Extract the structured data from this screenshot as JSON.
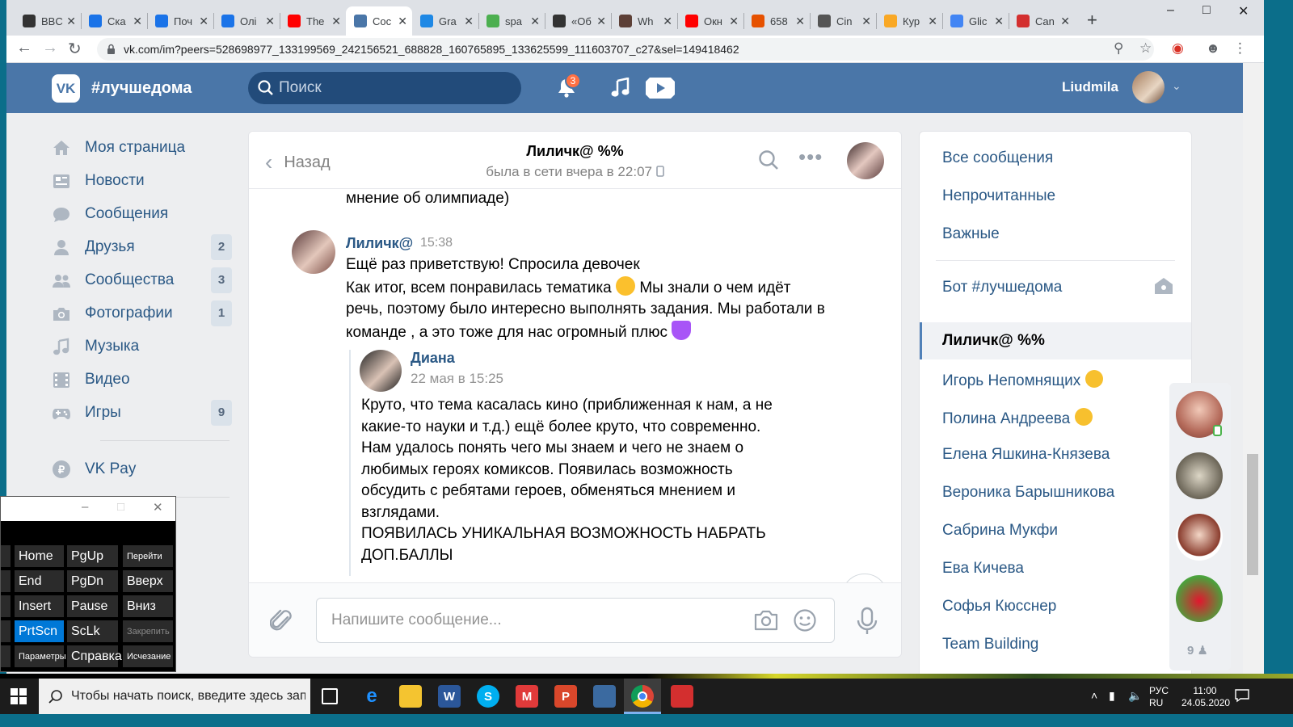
{
  "browser": {
    "tabs": [
      {
        "label": "BBC",
        "fav_color": "#333"
      },
      {
        "label": "Ска",
        "fav_color": "#1a73e8"
      },
      {
        "label": "Поч",
        "fav_color": "#1a73e8"
      },
      {
        "label": "Олі",
        "fav_color": "#1a73e8"
      },
      {
        "label": "The",
        "fav_color": "#ff0000"
      },
      {
        "label": "Сос",
        "fav_color": "#4a76a8"
      },
      {
        "label": "Gra",
        "fav_color": "#1e88e5"
      },
      {
        "label": "spa",
        "fav_color": "#4caf50"
      },
      {
        "label": "«Об",
        "fav_color": "#333"
      },
      {
        "label": "Wh",
        "fav_color": "#5d4037"
      },
      {
        "label": "Окн",
        "fav_color": "#ff0000"
      },
      {
        "label": "658",
        "fav_color": "#e65100"
      },
      {
        "label": "Cin",
        "fav_color": "#555"
      },
      {
        "label": "Кур",
        "fav_color": "#f9a825"
      },
      {
        "label": "Glic",
        "fav_color": "#4285f4"
      },
      {
        "label": "Can",
        "fav_color": "#d32f2f"
      }
    ],
    "active_tab": 5,
    "url": "vk.com/im?peers=528698977_133199569_242156521_688828_160765895_133625599_111603707_c27&sel=149418462"
  },
  "vk": {
    "logo": "VK",
    "group_tag": "#лучшедома",
    "search_placeholder": "Поиск",
    "notif_count": "3",
    "user_name": "Liudmila"
  },
  "nav": {
    "items": [
      {
        "label": "Моя страница",
        "icon": "home-icon",
        "count": ""
      },
      {
        "label": "Новости",
        "icon": "news-icon",
        "count": ""
      },
      {
        "label": "Сообщения",
        "icon": "messages-icon",
        "count": ""
      },
      {
        "label": "Друзья",
        "icon": "friends-icon",
        "count": "2"
      },
      {
        "label": "Сообщества",
        "icon": "communities-icon",
        "count": "3"
      },
      {
        "label": "Фотографии",
        "icon": "camera-icon",
        "count": "1"
      },
      {
        "label": "Музыка",
        "icon": "music-icon",
        "count": ""
      },
      {
        "label": "Видео",
        "icon": "video-icon",
        "count": ""
      },
      {
        "label": "Игры",
        "icon": "games-icon",
        "count": "9"
      }
    ],
    "vkpay": "VK Pay"
  },
  "chat": {
    "back_label": "Назад",
    "peer_name": "Лиличк@ %%",
    "peer_status": "была в сети вчера в 22:07",
    "prev_line": "мнение об олимпиаде)",
    "message": {
      "author": "Лиличк@",
      "time": "15:38",
      "line1": "Ещё раз приветствую! Спросила девочек",
      "line2a": "Как итог, всем понравилась тематика",
      "line2b": "Мы знали о чем идёт речь, поэтому было интересно выполнять задания. Мы работали в команде , а это тоже для нас огромный плюс"
    },
    "forwarded": {
      "author": "Диана",
      "date": "22 мая в 15:25",
      "lines": [
        "Круто, что тема касалась кино (приближенная к нам, а не",
        "какие-то науки и т.д.) ещё более круто, что современно.",
        "Нам удалось понять чего мы знаем и чего не знаем о",
        "любимых героях комиксов. Появилась возможность",
        "обсудить с ребятами героев, обменяться мнением и",
        "взглядами.",
        "ПОЯВИЛАСЬ УНИКАЛЬНАЯ ВОЗМОЖНОСТЬ НАБРАТЬ",
        "ДОП.БАЛЛЫ"
      ]
    },
    "input_placeholder": "Напишите сообщение..."
  },
  "right": {
    "filters": [
      "Все сообщения",
      "Непрочитанные",
      "Важные"
    ],
    "bot": "Бот #лучшедома",
    "chats": [
      {
        "name": "Лиличк@ %%",
        "emoji": false,
        "active": true
      },
      {
        "name": "Игорь Непомнящих",
        "emoji": true,
        "active": false
      },
      {
        "name": "Полина Андреева",
        "emoji": true,
        "active": false
      },
      {
        "name": "Елена Яшкина-Князева",
        "emoji": false,
        "active": false
      },
      {
        "name": "Вероника Барышникова",
        "emoji": false,
        "active": false
      },
      {
        "name": "Сабрина Мукфи",
        "emoji": false,
        "active": false
      },
      {
        "name": "Ева Кичева",
        "emoji": false,
        "active": false
      },
      {
        "name": "Софья Кюсснер",
        "emoji": false,
        "active": false
      },
      {
        "name": "Team Building",
        "emoji": false,
        "active": false
      }
    ],
    "rail_count": "9"
  },
  "osk": {
    "keys": [
      {
        "label": "Home",
        "col": 0,
        "row": 0,
        "style": ""
      },
      {
        "label": "PgUp",
        "col": 1,
        "row": 0,
        "style": ""
      },
      {
        "label": "Перейти",
        "col": 2,
        "row": 0,
        "style": "small"
      },
      {
        "label": "End",
        "col": 0,
        "row": 1,
        "style": ""
      },
      {
        "label": "PgDn",
        "col": 1,
        "row": 1,
        "style": ""
      },
      {
        "label": "Вверх",
        "col": 2,
        "row": 1,
        "style": ""
      },
      {
        "label": "Insert",
        "col": 0,
        "row": 2,
        "style": ""
      },
      {
        "label": "Pause",
        "col": 1,
        "row": 2,
        "style": ""
      },
      {
        "label": "Вниз",
        "col": 2,
        "row": 2,
        "style": ""
      },
      {
        "label": "PrtScn",
        "col": 0,
        "row": 3,
        "style": "on"
      },
      {
        "label": "ScLk",
        "col": 1,
        "row": 3,
        "style": ""
      },
      {
        "label": "Закрепить",
        "col": 2,
        "row": 3,
        "style": "dim"
      },
      {
        "label": "Параметры",
        "col": 0,
        "row": 4,
        "style": "small"
      },
      {
        "label": "Справка",
        "col": 1,
        "row": 4,
        "style": ""
      },
      {
        "label": "Исчезание",
        "col": 2,
        "row": 4,
        "style": "small"
      }
    ]
  },
  "taskbar": {
    "search_placeholder": "Чтобы начать поиск, введите здесь запрос",
    "lang_top": "РУС",
    "lang_bottom": "RU",
    "time": "11:00",
    "date": "24.05.2020"
  }
}
